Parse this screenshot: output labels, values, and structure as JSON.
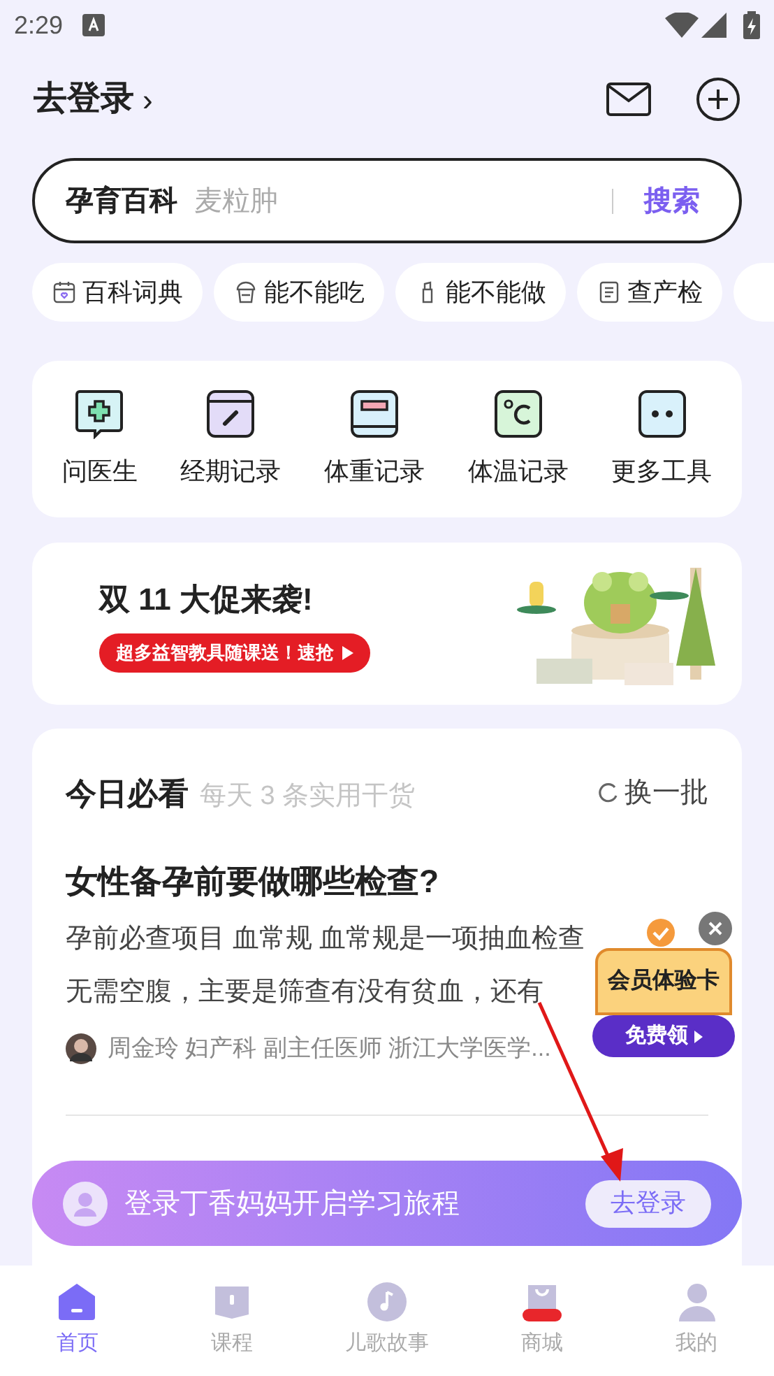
{
  "status_bar": {
    "time": "2:29"
  },
  "header": {
    "login_link": "去登录",
    "login_chevron": "›"
  },
  "search": {
    "brand": "孕育百科",
    "placeholder": "麦粒肿",
    "button": "搜索"
  },
  "chips": [
    {
      "label": "百科词典",
      "kind": "calendar"
    },
    {
      "label": "能不能吃",
      "kind": "cup"
    },
    {
      "label": "能不能做",
      "kind": "bottle"
    },
    {
      "label": "查产检",
      "kind": "doc"
    }
  ],
  "tools": [
    {
      "label": "问医生",
      "kind": "doctor",
      "color": "#d6f3f5"
    },
    {
      "label": "经期记录",
      "kind": "period",
      "color": "#e3dcf8"
    },
    {
      "label": "体重记录",
      "kind": "weight",
      "color": "#d8f0fb"
    },
    {
      "label": "体温记录",
      "kind": "temp",
      "color": "#d7f5d9"
    },
    {
      "label": "更多工具",
      "kind": "more",
      "color": "#d9f1fb"
    }
  ],
  "promo": {
    "title": "双 11 大促来袭!",
    "cta": "超多益智教具随课送！速抢"
  },
  "daily": {
    "title": "今日必看",
    "subtitle": "每天 3 条实用干货",
    "refresh": "换一批",
    "articles": [
      {
        "title": "女性备孕前要做哪些检查?",
        "lines": [
          "孕前必查项目 血常规 血常规是一项抽血检查",
          "无需空腹，主要是筛查有没有贫血，还有"
        ],
        "author": "周金玲 妇产科 副主任医师 浙江大学医学..."
      }
    ]
  },
  "member_card": {
    "title": "会员体验卡",
    "button": "免费领"
  },
  "login_bar": {
    "text": "登录丁香妈妈开启学习旅程",
    "button": "去登录"
  },
  "tabs": [
    {
      "label": "首页",
      "selected": true,
      "kind": "home"
    },
    {
      "label": "课程",
      "selected": false,
      "kind": "book"
    },
    {
      "label": "儿歌故事",
      "selected": false,
      "kind": "music"
    },
    {
      "label": "商城",
      "selected": false,
      "kind": "shop"
    },
    {
      "label": "我的",
      "selected": false,
      "kind": "person"
    }
  ]
}
